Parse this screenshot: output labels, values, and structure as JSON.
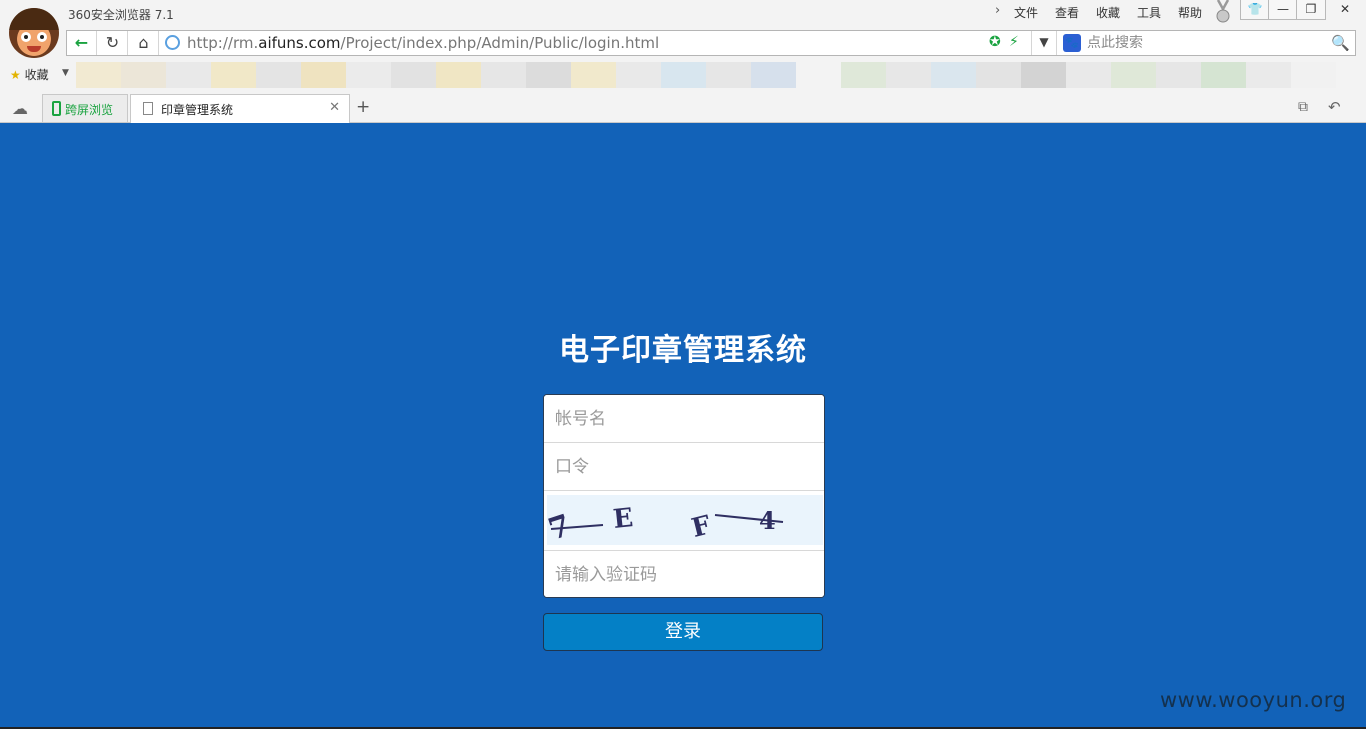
{
  "window": {
    "title": "360安全浏览器 7.1",
    "menu": [
      "文件",
      "查看",
      "收藏",
      "工具",
      "帮助"
    ],
    "controls": {
      "skin": "👕",
      "minimize": "—",
      "restore": "❐",
      "close": "✕"
    }
  },
  "address_bar": {
    "url_prefix": "http://rm.",
    "url_domain": "aifuns.com",
    "url_path": "/Project/index.php/Admin/Public/login.html",
    "search_placeholder": "点此搜索"
  },
  "favorites": {
    "label": "收藏"
  },
  "tabs": [
    {
      "label": "跨屏浏览",
      "active": false
    },
    {
      "label": "印章管理系统",
      "active": true
    }
  ],
  "page": {
    "title": "电子印章管理系统",
    "username_placeholder": "帐号名",
    "password_placeholder": "口令",
    "captcha_text": "7 E F 4",
    "captcha_placeholder": "请输入验证码",
    "login_label": "登录"
  },
  "watermark": "www.wooyun.org",
  "colors": {
    "background": "#1262b8",
    "login_button": "#0480c6",
    "captcha_bg": "#eaf4fc",
    "captcha_ink": "#2f2f62",
    "accent_green": "#1aa340"
  },
  "icons": [
    "back-arrow-icon",
    "refresh-icon",
    "home-icon",
    "globe-icon",
    "security-shield-icon",
    "speed-lightning-icon",
    "chevron-down-icon",
    "baidu-paw-icon",
    "search-icon",
    "star-icon",
    "cloud-icon",
    "phone-icon",
    "document-icon",
    "close-icon",
    "plus-icon",
    "restore-tabs-icon",
    "undo-icon",
    "medal-icon"
  ]
}
